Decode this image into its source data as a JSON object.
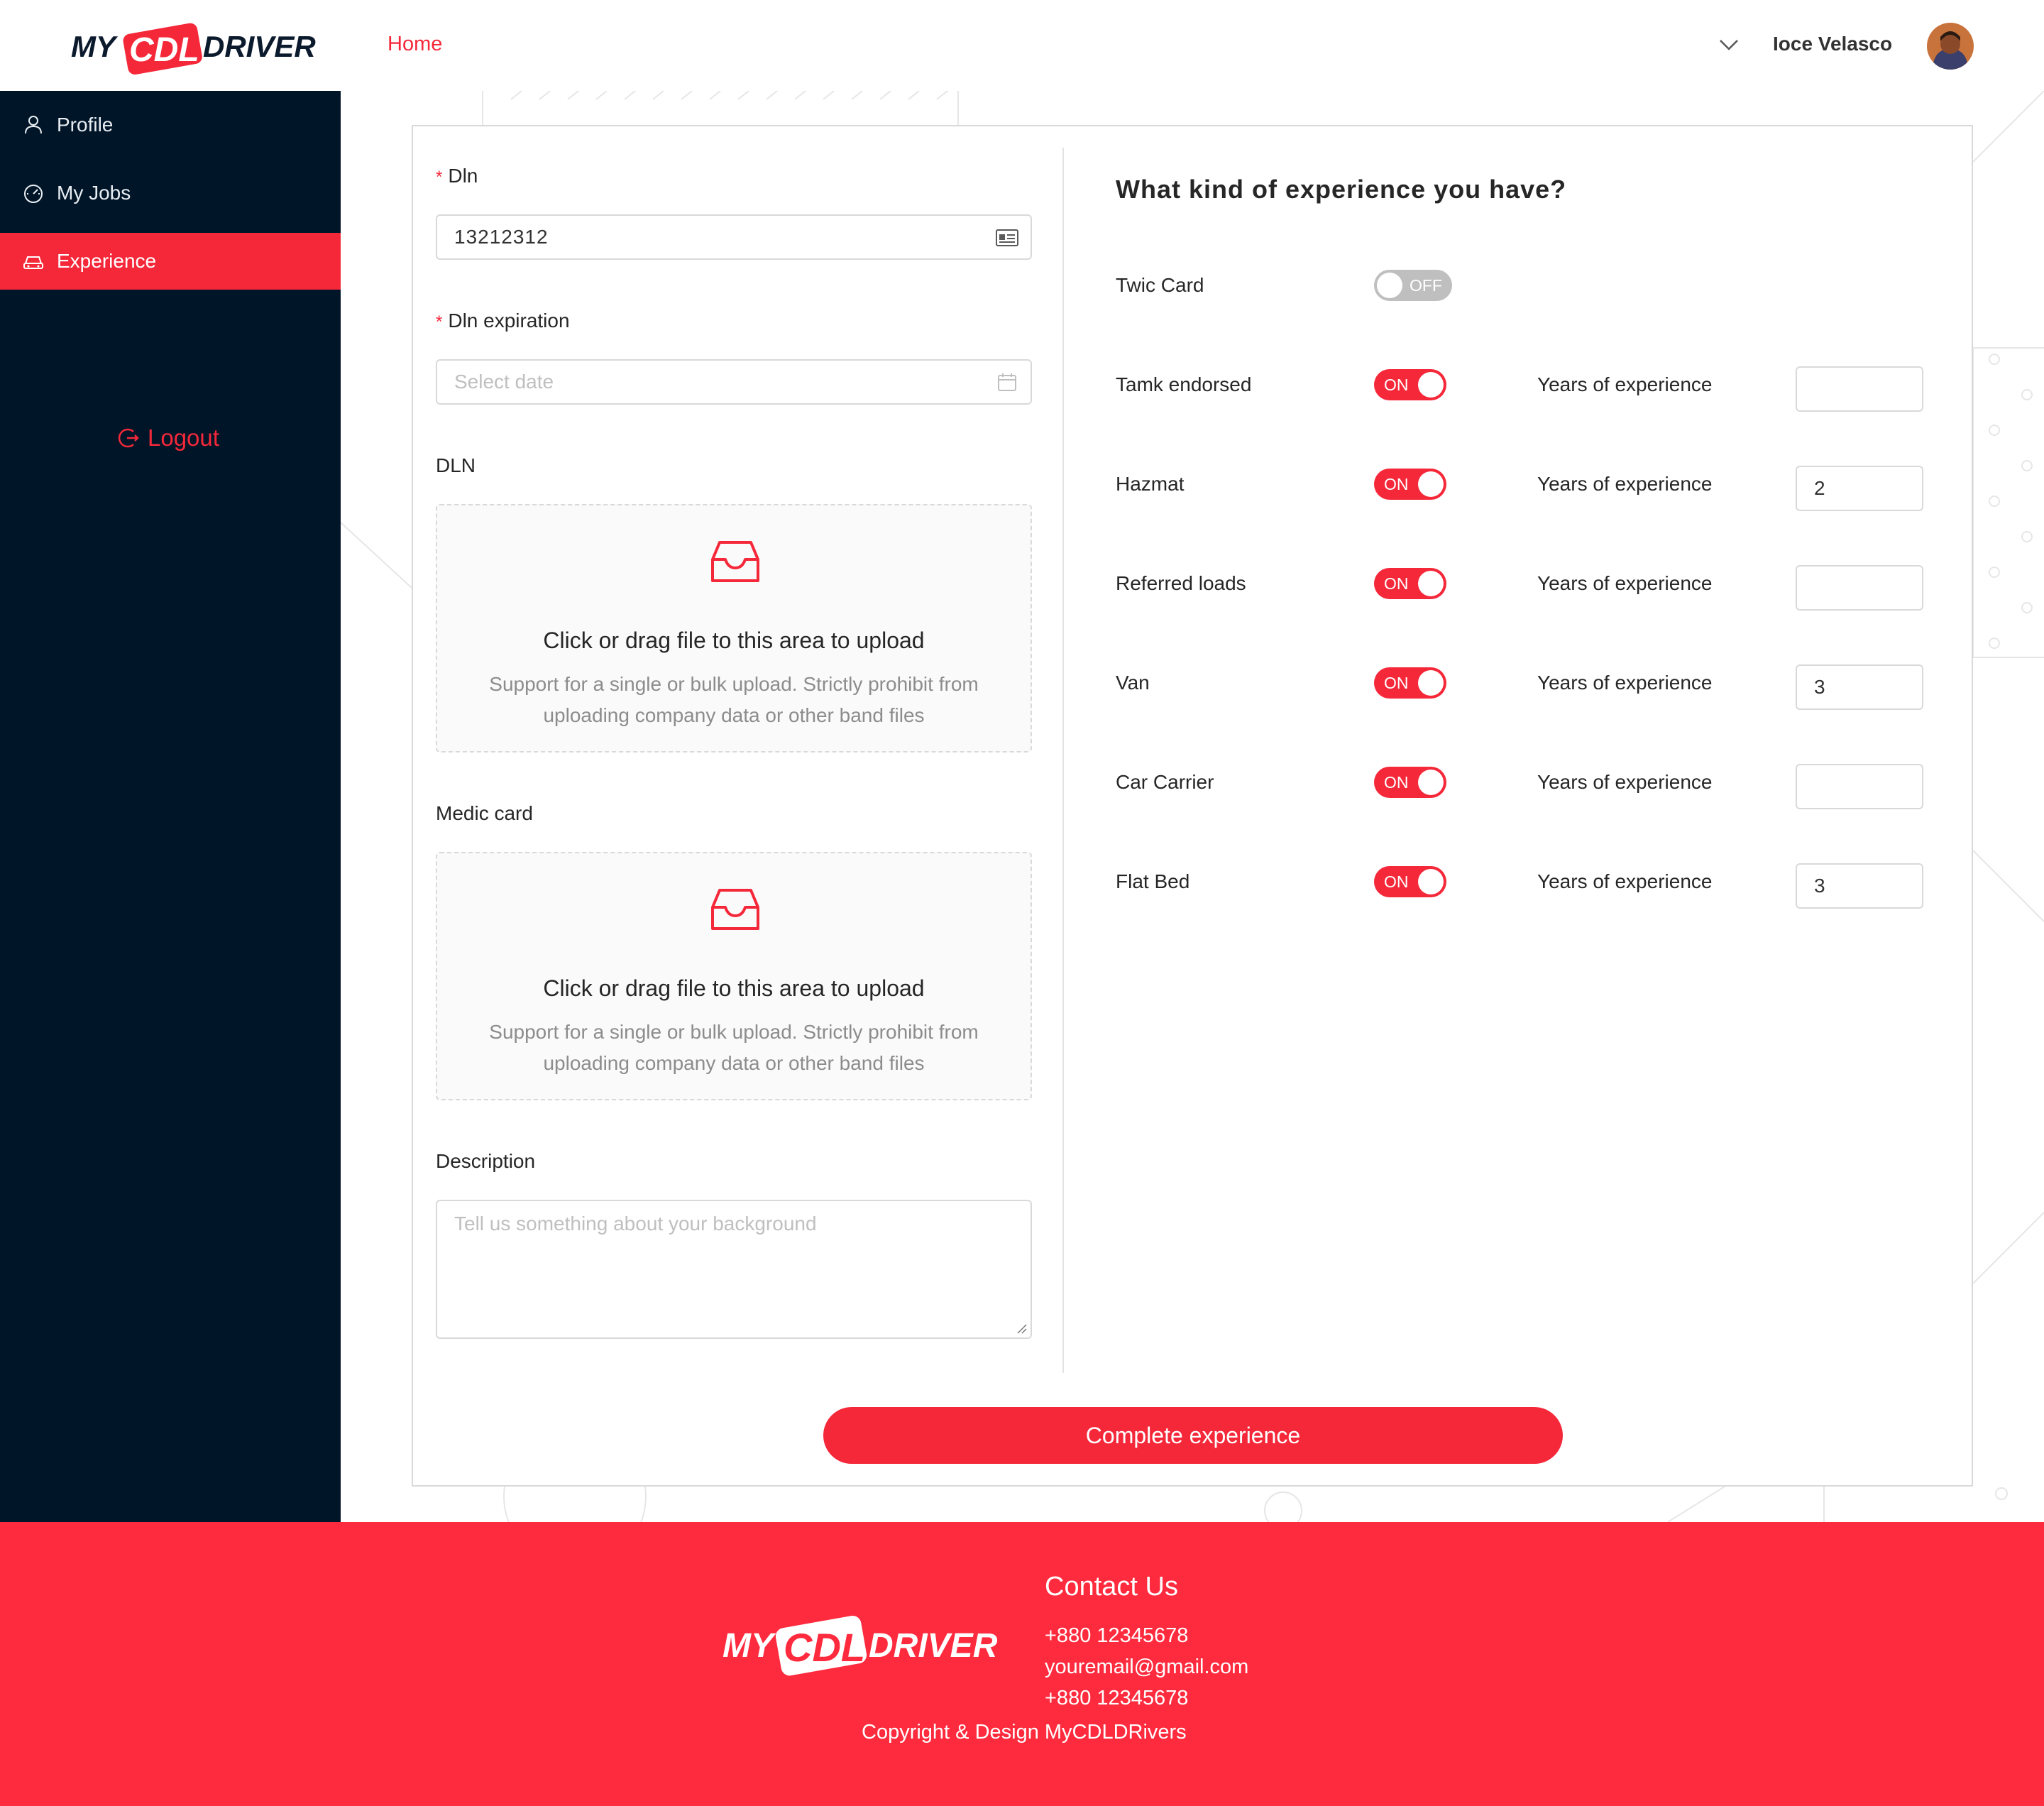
{
  "brand": {
    "logo_left": "MY",
    "logo_mid": "CDL",
    "logo_right": "DRIVER"
  },
  "header": {
    "nav_home": "Home",
    "user_name": "Ioce Velasco"
  },
  "sidebar": {
    "items": [
      {
        "label": "Profile",
        "icon": "user-icon"
      },
      {
        "label": "My Jobs",
        "icon": "dashboard-icon"
      },
      {
        "label": "Experience",
        "icon": "car-icon",
        "active": true
      }
    ],
    "logout": "Logout"
  },
  "form": {
    "dln_label": "Dln",
    "dln_value": "13212312",
    "dln_exp_label": "Dln expiration",
    "dln_exp_placeholder": "Select date",
    "upload_dln_label": "DLN",
    "upload_medic_label": "Medic card",
    "upload_title": "Click or drag file to this area to upload",
    "upload_hint": "Support for a single or bulk upload. Strictly prohibit from uploading company data or other band files",
    "description_label": "Description",
    "description_placeholder": "Tell us something about your background",
    "required_mark": "*"
  },
  "experience": {
    "question": "What kind of experience you have?",
    "years_label": "Years of experience",
    "on_text": "ON",
    "off_text": "OFF",
    "twic": {
      "label": "Twic Card",
      "state": "OFF"
    },
    "rows": [
      {
        "label": "Tamk endorsed",
        "state": "ON",
        "years": ""
      },
      {
        "label": "Hazmat",
        "state": "ON",
        "years": "2"
      },
      {
        "label": "Referred loads",
        "state": "ON",
        "years": ""
      },
      {
        "label": "Van",
        "state": "ON",
        "years": "3"
      },
      {
        "label": "Car Carrier",
        "state": "ON",
        "years": ""
      },
      {
        "label": "Flat Bed",
        "state": "ON",
        "years": "3"
      }
    ],
    "submit_label": "Complete experience"
  },
  "footer": {
    "contact_title": "Contact Us",
    "phone_1": "+880 12345678",
    "email": "youremail@gmail.com",
    "phone_2": "+880 12345678",
    "copyright": "Copyright & Design MyCDLDRivers"
  },
  "colors": {
    "accent": "#f5283a",
    "sidebar": "#011528",
    "footer": "#fe2a3d"
  }
}
